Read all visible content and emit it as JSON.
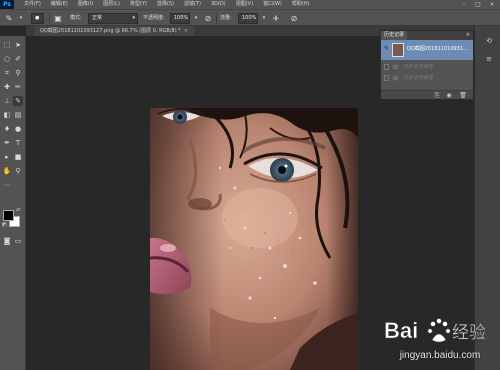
{
  "app": {
    "logo": "Ps",
    "menu": [
      "文件(F)",
      "编辑(E)",
      "图像(I)",
      "图层(L)",
      "类型(Y)",
      "选择(S)",
      "滤镜(T)",
      "3D(D)",
      "视图(V)",
      "窗口(W)",
      "帮助(H)"
    ],
    "window_controls": [
      "–",
      "□",
      "×"
    ]
  },
  "options": {
    "mode_label": "模式:",
    "mode_value": "正常",
    "opacity_label": "不透明度:",
    "opacity_value": "100%",
    "flow_label": "流量:",
    "flow_value": "100%"
  },
  "document": {
    "tab_title": "QQ截图20181101093127.png @ 66.7% (图层 0, RGB/8) *",
    "close_glyph": "×"
  },
  "history_panel": {
    "tab_label": "历史记录",
    "snapshot_label": "QQ截图201811010931...",
    "menu_glyph": "≡",
    "items": [
      "历史记录画笔",
      "历史记录画笔"
    ]
  },
  "watermark": {
    "url": "jingyan.baidu.com"
  },
  "colors": {
    "foreground": "#000000",
    "background": "#ffffff",
    "selection": "#6d8bb3"
  }
}
